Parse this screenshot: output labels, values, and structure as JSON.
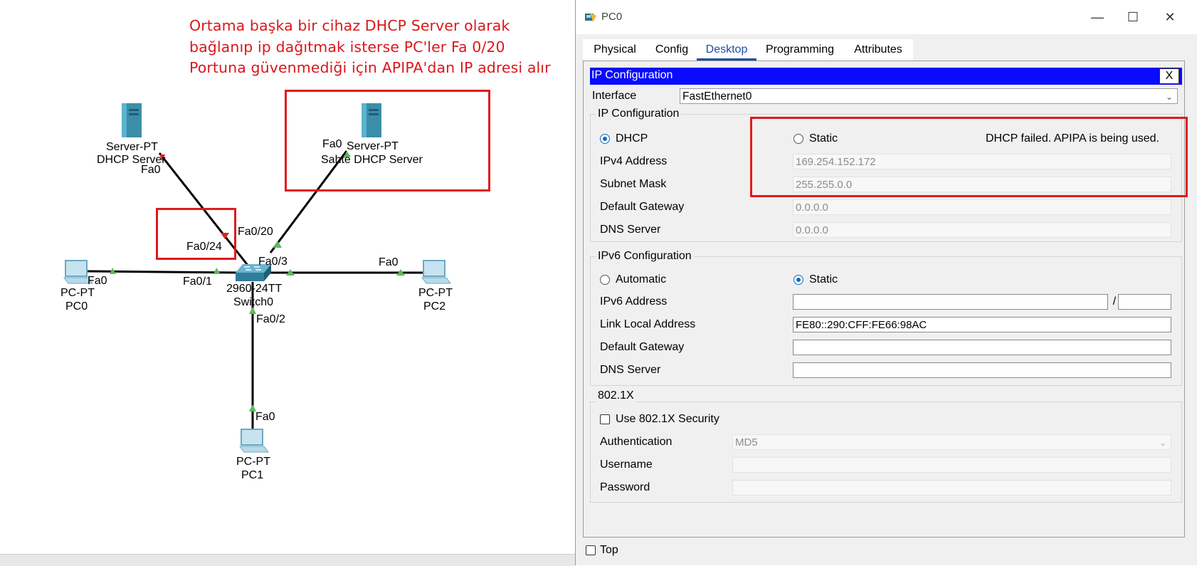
{
  "annotation": {
    "lines": [
      "Ortama başka bir cihaz DHCP Server olarak",
      "bağlanıp ip dağıtmak isterse PC'ler Fa 0/20",
      "Portuna güvenmediği için APIPA'dan IP adresi alır"
    ]
  },
  "topology": {
    "server1": {
      "model": "Server-PT",
      "name": "DHCP Server",
      "port": "Fa0"
    },
    "server2": {
      "model": "Server-PT",
      "name": "Sahte DHCP Server",
      "port": "Fa0"
    },
    "switch": {
      "model": "2960-24TT",
      "name": "Switch0",
      "ports": {
        "fa0_24": "Fa0/24",
        "fa0_20": "Fa0/20",
        "fa0_3": "Fa0/3",
        "fa0_1": "Fa0/1",
        "fa0_2": "Fa0/2"
      }
    },
    "pc0": {
      "model": "PC-PT",
      "name": "PC0",
      "port": "Fa0"
    },
    "pc1": {
      "model": "PC-PT",
      "name": "PC1",
      "port": "Fa0"
    },
    "pc2": {
      "model": "PC-PT",
      "name": "PC2",
      "port": "Fa0"
    },
    "link_colors": {
      "up": "#5cb85c",
      "down": "#d9241e"
    }
  },
  "window": {
    "title": "PC0",
    "tabs": [
      "Physical",
      "Config",
      "Desktop",
      "Programming",
      "Attributes"
    ],
    "active_tab": "Desktop",
    "top_checkbox_label": "Top"
  },
  "ipconfig": {
    "title": "IP Configuration",
    "close_label": "X",
    "interface_label": "Interface",
    "interface_value": "FastEthernet0",
    "ipv4": {
      "section_title": "IP Configuration",
      "dhcp_label": "DHCP",
      "static_label": "Static",
      "selected": "DHCP",
      "status": "DHCP failed. APIPA is being used.",
      "address_label": "IPv4 Address",
      "address": "169.254.152.172",
      "mask_label": "Subnet Mask",
      "mask": "255.255.0.0",
      "gateway_label": "Default Gateway",
      "gateway": "0.0.0.0",
      "dns_label": "DNS Server",
      "dns": "0.0.0.0"
    },
    "ipv6": {
      "section_title": "IPv6 Configuration",
      "automatic_label": "Automatic",
      "static_label": "Static",
      "selected": "Static",
      "address_label": "IPv6 Address",
      "address": "",
      "prefix_separator": "/",
      "prefix": "",
      "link_local_label": "Link Local Address",
      "link_local": "FE80::290:CFF:FE66:98AC",
      "gateway_label": "Default Gateway",
      "gateway": "",
      "dns_label": "DNS Server",
      "dns": ""
    },
    "dot1x": {
      "section_title": "802.1X",
      "use_label": "Use 802.1X Security",
      "use_checked": false,
      "auth_label": "Authentication",
      "auth_value": "MD5",
      "username_label": "Username",
      "username": "",
      "password_label": "Password",
      "password": ""
    }
  },
  "highlight_color": "#e01a1a"
}
